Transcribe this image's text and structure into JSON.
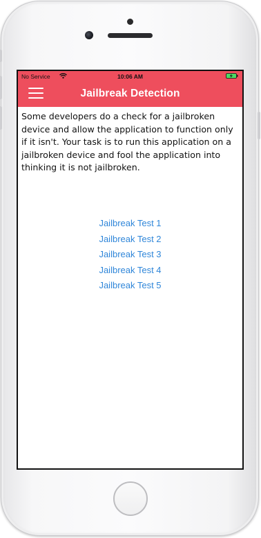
{
  "status_bar": {
    "carrier": "No Service",
    "time": "10:06 AM"
  },
  "nav": {
    "title": "Jailbreak Detection",
    "menu_icon": "hamburger-menu-icon"
  },
  "content": {
    "description": "Some developers do a check for a jailbroken device and allow the application to function only if it isn't. Your task is to run this application on a jailbroken device and fool the application into thinking it is not jailbroken."
  },
  "tests": [
    {
      "label": "Jailbreak Test 1"
    },
    {
      "label": "Jailbreak Test 2"
    },
    {
      "label": "Jailbreak Test 3"
    },
    {
      "label": "Jailbreak Test 4"
    },
    {
      "label": "Jailbreak Test 5"
    }
  ],
  "colors": {
    "header_bg": "#ee4e5d",
    "link": "#2f86d9",
    "battery_charge": "#4cd964"
  }
}
